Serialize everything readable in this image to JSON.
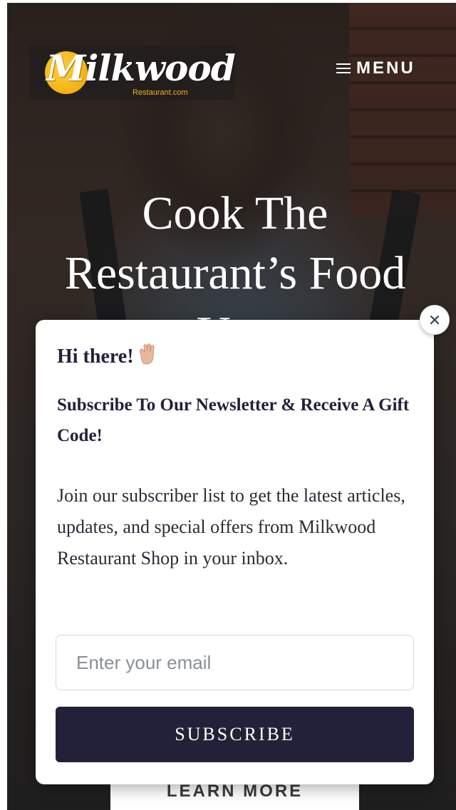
{
  "header": {
    "logo": {
      "text": "Milkwood",
      "subtext": "Restaurant.com"
    },
    "menu": {
      "icon": "hamburger-icon",
      "label": "MENU"
    }
  },
  "hero": {
    "title_line1": "Cook The",
    "title_line2": "Restaurant’s Food",
    "title_line3": "You",
    "learn_more_label": "LEARN MORE"
  },
  "popup": {
    "close_icon": "close-icon",
    "greeting": "Hi there!",
    "greeting_icon": "waving-hand-icon",
    "headline": "Subscribe To Our Newsletter & Receive A Gift Code!",
    "body": "Join our subscriber list to get the latest articles, updates, and special offers from Milkwood Restaurant Shop in your inbox.",
    "email": {
      "placeholder": "Enter your email",
      "value": ""
    },
    "subscribe_label": "SUBSCRIBE"
  },
  "colors": {
    "popup_dark": "#23213a",
    "logo_accent": "#f2b01a"
  }
}
